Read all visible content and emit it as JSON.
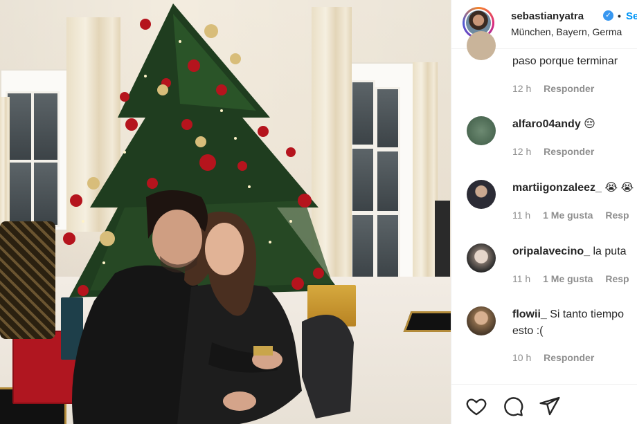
{
  "post": {
    "author": "sebastianyatra",
    "verified_mark": "✓",
    "separator": "•",
    "follow_label": "Se",
    "location": "München, Bayern, Germa"
  },
  "comments": [
    {
      "username": "",
      "text": "paso porque terminar",
      "time": "12 h",
      "likes": "",
      "reply": "Responder",
      "avatar_color": "#c9b49a"
    },
    {
      "username": "alfaro04andy",
      "text": "😔",
      "time": "12 h",
      "likes": "",
      "reply": "Responder",
      "avatar_color": "#3d5a45"
    },
    {
      "username": "martiigonzaleez_",
      "text": "😭 😭",
      "time": "11 h",
      "likes": "1 Me gusta",
      "reply": "Resp",
      "avatar_color": "#2b2b35"
    },
    {
      "username": "oripalavecino_",
      "text": "la puta",
      "time": "11 h",
      "likes": "1 Me gusta",
      "reply": "Resp",
      "avatar_color": "#7a6e66"
    },
    {
      "username": "flowii_",
      "text": "Si tanto tiempo",
      "text2": "esto :(",
      "time": "10 h",
      "likes": "",
      "reply": "Responder",
      "avatar_color": "#8a6a4a"
    }
  ],
  "actions": {
    "like": "heart-icon",
    "comment": "comment-icon",
    "share": "share-icon"
  },
  "colors": {
    "link": "#0095f6",
    "verified": "#3897f0",
    "meta": "#8e8e8e"
  }
}
